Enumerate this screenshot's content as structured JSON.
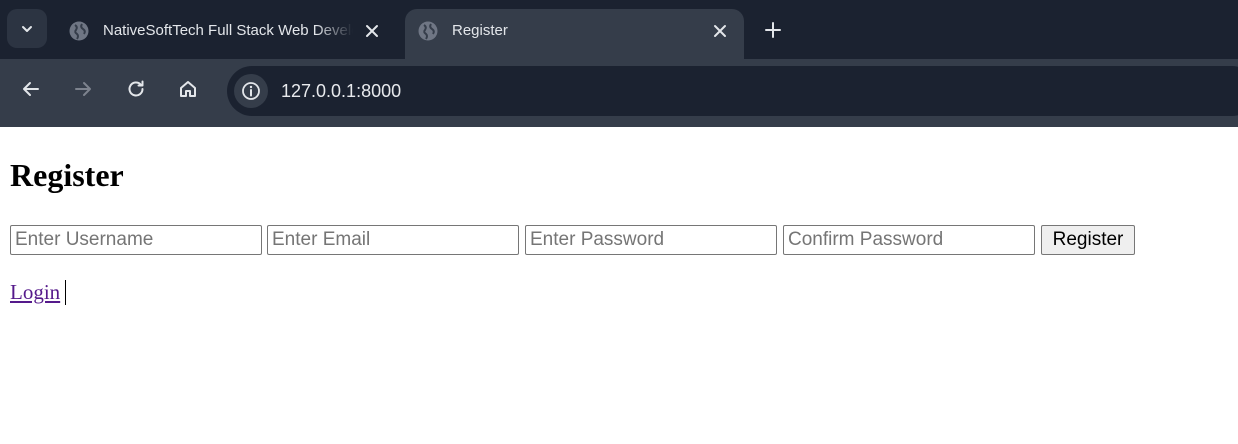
{
  "browser": {
    "tabs": [
      {
        "title": "NativeSoftTech Full Stack Web Develo",
        "active": false,
        "favicon": "globe-icon"
      },
      {
        "title": "Register",
        "active": true,
        "favicon": "globe-icon"
      }
    ],
    "address": {
      "url": "127.0.0.1:8000"
    }
  },
  "page": {
    "heading": "Register",
    "fields": [
      {
        "placeholder": "Enter Username"
      },
      {
        "placeholder": "Enter Email"
      },
      {
        "placeholder": "Enter Password"
      },
      {
        "placeholder": "Confirm Password"
      }
    ],
    "submit_label": "Register",
    "login_link": "Login"
  },
  "colors": {
    "chrome_dark": "#1b2230",
    "chrome_toolbar": "#353d4a",
    "visited_link": "#551a8b"
  }
}
